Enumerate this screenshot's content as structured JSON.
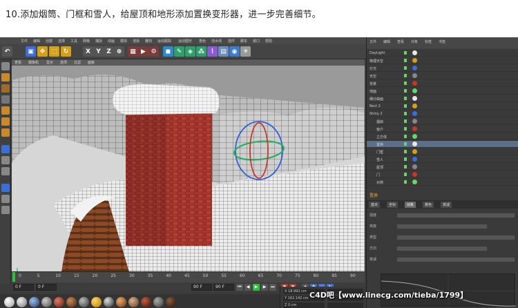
{
  "heading": {
    "text": "10.添加烟筒、门框和雪人，给屋顶和地形添加置换变形器，进一步完善细节。"
  },
  "app": {
    "menubar": [
      "文件",
      "编辑",
      "创建",
      "选择",
      "工具",
      "网格",
      "捕捉",
      "动画",
      "模拟",
      "渲染",
      "雕刻",
      "运动跟踪",
      "运动图形",
      "角色",
      "流水线",
      "插件",
      "脚本",
      "窗口",
      "帮助"
    ],
    "toolbar": {
      "axis_x": "X",
      "axis_y": "Y",
      "axis_z": "Z"
    },
    "viewport_menu": [
      "查看",
      "摄像机",
      "显示",
      "选项",
      "过滤",
      "面板"
    ],
    "timeline": {
      "ticks": [
        "0",
        "5",
        "10",
        "15",
        "20",
        "25",
        "30",
        "35",
        "40",
        "45",
        "50",
        "55",
        "60",
        "65",
        "70",
        "75",
        "80",
        "85",
        "90"
      ],
      "end_frame": "90 F"
    },
    "transport": {
      "current_frame": "0 F",
      "start_field": "0 F",
      "end_field": "90 F",
      "fps_field": "90 F"
    },
    "coords": {
      "x": "X 18.992 cm",
      "y": "Y 162.142 cm",
      "z": "Z 0 cm"
    }
  },
  "object_manager": {
    "menu": [
      "文件",
      "编辑",
      "查看",
      "对象",
      "标签",
      "书签"
    ],
    "rows": [
      {
        "name": "DayLight"
      },
      {
        "name": "物理天空"
      },
      {
        "name": "灯光"
      },
      {
        "name": "天空"
      },
      {
        "name": "背景"
      },
      {
        "name": "地面"
      },
      {
        "name": "细分曲面"
      },
      {
        "name": "Rect 2"
      },
      {
        "name": "Shiny 2"
      },
      {
        "name": "烟囱"
      },
      {
        "name": "窗户"
      },
      {
        "name": "立方体"
      },
      {
        "name": "置换"
      },
      {
        "name": "门框"
      },
      {
        "name": "雪人"
      },
      {
        "name": "屋顶"
      },
      {
        "name": "门"
      },
      {
        "name": "对称"
      }
    ]
  },
  "attributes": {
    "title": "置换",
    "tabs": [
      "基本",
      "坐标",
      "对象",
      "着色",
      "衰减"
    ],
    "lines": [
      "强度",
      "高度",
      "类型",
      "方向",
      "衰减"
    ]
  },
  "watermark": "C4D吧【www.linecg.com/tieba/1799】",
  "colors": {
    "accent": "#e0a040",
    "timeline_playhead": "#2fbf3a",
    "axis_x": "#c0392b",
    "axis_y": "#27ae60",
    "axis_z": "#2c5fd8"
  }
}
